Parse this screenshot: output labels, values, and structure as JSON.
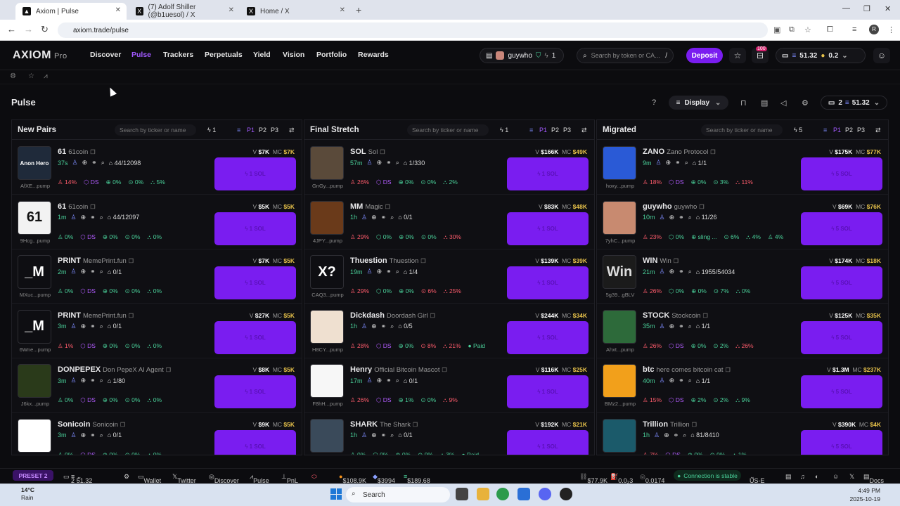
{
  "browser": {
    "tabs": [
      {
        "title": "Axiom | Pulse",
        "icon": "axiom-icon"
      },
      {
        "title": "(7) Adolf Shiller (@b1uesol) / X",
        "icon": "x-icon"
      },
      {
        "title": "Home / X",
        "icon": "x-icon"
      }
    ],
    "url": "axiom.trade/pulse"
  },
  "nav": {
    "logo": "AXIOM",
    "logo_sub": "Pro",
    "links": [
      "Discover",
      "Pulse",
      "Trackers",
      "Perpetuals",
      "Yield",
      "Vision",
      "Portfolio",
      "Rewards"
    ],
    "active": "Pulse",
    "user": "guywho",
    "user_count": "1",
    "search_placeholder": "Search by token or CA...",
    "search_shortcut": "/",
    "deposit": "Deposit",
    "notif_badge": "100",
    "balance": "51.32",
    "balance2": "0.2"
  },
  "page": {
    "title": "Pulse",
    "display": "Display",
    "wallet_count": "2",
    "wallet_balance": "51.32"
  },
  "columns": [
    {
      "title": "New Pairs",
      "search": "Search by ticker or name",
      "amount": "1",
      "presets": [
        "P1",
        "P2",
        "P3"
      ],
      "cards": [
        {
          "ticker": "61",
          "name": "61coin",
          "age": "37s",
          "holders": "44/12098",
          "addr": "AfXE...pump",
          "v": "$7K",
          "mc": "$7K",
          "stats": [
            "14%",
            "DS",
            "0%",
            "0%",
            "5%"
          ],
          "avatar": "Anon Hero"
        },
        {
          "ticker": "61",
          "name": "61coin",
          "age": "1m",
          "holders": "44/12097",
          "addr": "9Hcg...pump",
          "v": "$5K",
          "mc": "$5K",
          "stats": [
            "0%",
            "DS",
            "0%",
            "0%",
            "0%"
          ],
          "avatar": "61"
        },
        {
          "ticker": "PRINT",
          "name": "MemePrint.fun",
          "age": "2m",
          "holders": "0/1",
          "addr": "MXuc...pump",
          "v": "$7K",
          "mc": "$5K",
          "stats": [
            "0%",
            "DS",
            "0%",
            "0%",
            "0%"
          ],
          "avatar": "_M"
        },
        {
          "ticker": "PRINT",
          "name": "MemePrint.fun",
          "age": "3m",
          "holders": "0/1",
          "addr": "6Wne...pump",
          "v": "$27K",
          "mc": "$5K",
          "stats": [
            "1%",
            "DS",
            "0%",
            "0%",
            "0%"
          ],
          "avatar": "_M"
        },
        {
          "ticker": "DONPEPEX",
          "name": "Don PepeX AI Agent",
          "age": "3m",
          "holders": "1/80",
          "addr": "J6kx...pump",
          "v": "$8K",
          "mc": "$5K",
          "stats": [
            "0%",
            "DS",
            "0%",
            "0%",
            "0%"
          ],
          "avatar": ""
        },
        {
          "ticker": "Sonicoin",
          "name": "Sonicoin",
          "age": "3m",
          "holders": "0/1",
          "addr": "",
          "v": "$9K",
          "mc": "$5K",
          "stats": [
            "0%",
            "DS",
            "0%",
            "0%",
            "0%"
          ],
          "avatar": ""
        }
      ]
    },
    {
      "title": "Final Stretch",
      "search": "Search by ticker or name",
      "amount": "1",
      "presets": [
        "P1",
        "P2",
        "P3"
      ],
      "cards": [
        {
          "ticker": "SOL",
          "name": "Sol",
          "age": "57m",
          "holders": "1/330",
          "addr": "GnGy...pump",
          "v": "$166K",
          "mc": "$49K",
          "stats": [
            "26%",
            "DS",
            "0%",
            "0%",
            "2%"
          ],
          "avatar": ""
        },
        {
          "ticker": "MM",
          "name": "Magic",
          "age": "1h",
          "holders": "0/1",
          "addr": "4JPY...pump",
          "v": "$83K",
          "mc": "$48K",
          "stats": [
            "29%",
            "0%",
            "0%",
            "0%",
            "30%"
          ],
          "avatar": ""
        },
        {
          "ticker": "Thuestion",
          "name": "Thuestion",
          "age": "19m",
          "holders": "1/4",
          "addr": "CAQ3...pump",
          "v": "$139K",
          "mc": "$39K",
          "stats": [
            "29%",
            "0%",
            "0%",
            "6%",
            "25%"
          ],
          "avatar": "X?"
        },
        {
          "ticker": "Dickdash",
          "name": "Doordash Girl",
          "age": "1h",
          "holders": "0/5",
          "addr": "H8CY...pump",
          "v": "$244K",
          "mc": "$34K",
          "stats": [
            "28%",
            "DS",
            "0%",
            "8%",
            "21%"
          ],
          "paid": "Paid",
          "avatar": ""
        },
        {
          "ticker": "Henry",
          "name": "Official Bitcoin Mascot",
          "age": "17m",
          "holders": "0/1",
          "addr": "F8hH...pump",
          "v": "$116K",
          "mc": "$25K",
          "stats": [
            "26%",
            "DS",
            "1%",
            "0%",
            "9%"
          ],
          "avatar": ""
        },
        {
          "ticker": "SHARK",
          "name": "The Shark",
          "age": "1h",
          "holders": "0/1",
          "addr": "",
          "v": "$192K",
          "mc": "$21K",
          "stats": [
            "0%",
            "0%",
            "0%",
            "0%",
            "3%"
          ],
          "paid": "Paid",
          "avatar": ""
        }
      ]
    },
    {
      "title": "Migrated",
      "search": "Search by ticker or name",
      "amount": "5",
      "presets": [
        "P1",
        "P2",
        "P3"
      ],
      "cards": [
        {
          "ticker": "ZANO",
          "name": "Zano Protocol",
          "age": "9m",
          "holders": "1/1",
          "addr": "hoxy...pump",
          "v": "$175K",
          "mc": "$77K",
          "stats": [
            "18%",
            "DS",
            "0%",
            "3%",
            "11%"
          ],
          "avatar": ""
        },
        {
          "ticker": "guywho",
          "name": "guywho",
          "age": "10m",
          "holders": "11/26",
          "addr": "7yhC...pump",
          "v": "$69K",
          "mc": "$76K",
          "stats": [
            "23%",
            "0%",
            "sling ...",
            "6%",
            "4%",
            "4%"
          ],
          "avatar": ""
        },
        {
          "ticker": "WIN",
          "name": "Win",
          "age": "21m",
          "holders": "1955/54034",
          "addr": "5g39...gBLV",
          "v": "$174K",
          "mc": "$18K",
          "stats": [
            "26%",
            "0%",
            "0%",
            "7%",
            "0%"
          ],
          "avatar": "Win"
        },
        {
          "ticker": "STOCK",
          "name": "Stockcoin",
          "age": "35m",
          "holders": "1/1",
          "addr": "Ahxt...pump",
          "v": "$125K",
          "mc": "$35K",
          "stats": [
            "26%",
            "DS",
            "0%",
            "2%",
            "26%"
          ],
          "avatar": ""
        },
        {
          "ticker": "btc",
          "name": "here comes bitcoin cat",
          "age": "40m",
          "holders": "1/1",
          "addr": "BMz2...pump",
          "v": "$1.3M",
          "mc": "$237K",
          "stats": [
            "15%",
            "DS",
            "2%",
            "2%",
            "9%"
          ],
          "avatar": ""
        },
        {
          "ticker": "Trillion",
          "name": "Trillion",
          "age": "1h",
          "holders": "81/8410",
          "addr": "",
          "v": "$390K",
          "mc": "$4K",
          "stats": [
            "7%",
            "DS",
            "0%",
            "0%",
            "1%"
          ],
          "avatar": ""
        }
      ]
    }
  ],
  "buy_label": "1 SOL",
  "buy_label_migrated": "5 SOL",
  "footer": {
    "preset": "PRESET 2",
    "wallet_count": "2",
    "wallet_balance": "51.32",
    "links": [
      "Wallet",
      "Twitter",
      "Discover",
      "Pulse",
      "PnL"
    ],
    "btc": "$108.9K",
    "eth": "$3994",
    "sol": "$189.68",
    "stat1": "$77.9K",
    "stat2": "0.0₂3",
    "stat3": "0.0174",
    "connection": "Connection is stable",
    "region": "US-E",
    "docs": "Docs"
  },
  "taskbar": {
    "temp": "14°C",
    "weather": "Rain",
    "search": "Search",
    "time": "4:49 PM",
    "date": "2025-10-19"
  }
}
